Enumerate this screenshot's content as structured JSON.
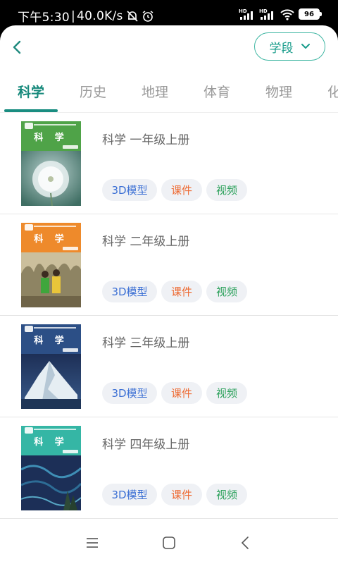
{
  "status_bar": {
    "time": "下午5:30",
    "speed": "40.0K/s",
    "signal_label_1": "HD",
    "signal_label_2": "HD",
    "battery": "96"
  },
  "header": {
    "stage_button_label": "学段"
  },
  "tabs": [
    {
      "label": "科学",
      "active": true
    },
    {
      "label": "历史",
      "active": false
    },
    {
      "label": "地理",
      "active": false
    },
    {
      "label": "体育",
      "active": false
    },
    {
      "label": "物理",
      "active": false
    },
    {
      "label": "化",
      "active": false
    }
  ],
  "books": [
    {
      "title": "科学 一年级上册",
      "cover_title": "科 学",
      "cover_color": "#4fa348",
      "tags": [
        "3D模型",
        "课件",
        "视频"
      ]
    },
    {
      "title": "科学 二年级上册",
      "cover_title": "科 学",
      "cover_color": "#ee8a2b",
      "tags": [
        "3D模型",
        "课件",
        "视频"
      ]
    },
    {
      "title": "科学 三年级上册",
      "cover_title": "科 学",
      "cover_color": "#2c4f86",
      "tags": [
        "3D模型",
        "课件",
        "视频"
      ]
    },
    {
      "title": "科学 四年级上册",
      "cover_title": "科 学",
      "cover_color": "#35b6a5",
      "tags": [
        "3D模型",
        "课件",
        "视频"
      ]
    }
  ],
  "colors": {
    "accent": "#1a8d81",
    "tag_3d": "#3b6fd4",
    "tag_courseware": "#ee6a32",
    "tag_video": "#2aa05a"
  },
  "icons": {
    "back": "chevron-left-icon",
    "stage_dropdown": "chevron-down-icon",
    "nav_menu": "menu-icon",
    "nav_home": "home-icon",
    "nav_back": "back-icon"
  }
}
